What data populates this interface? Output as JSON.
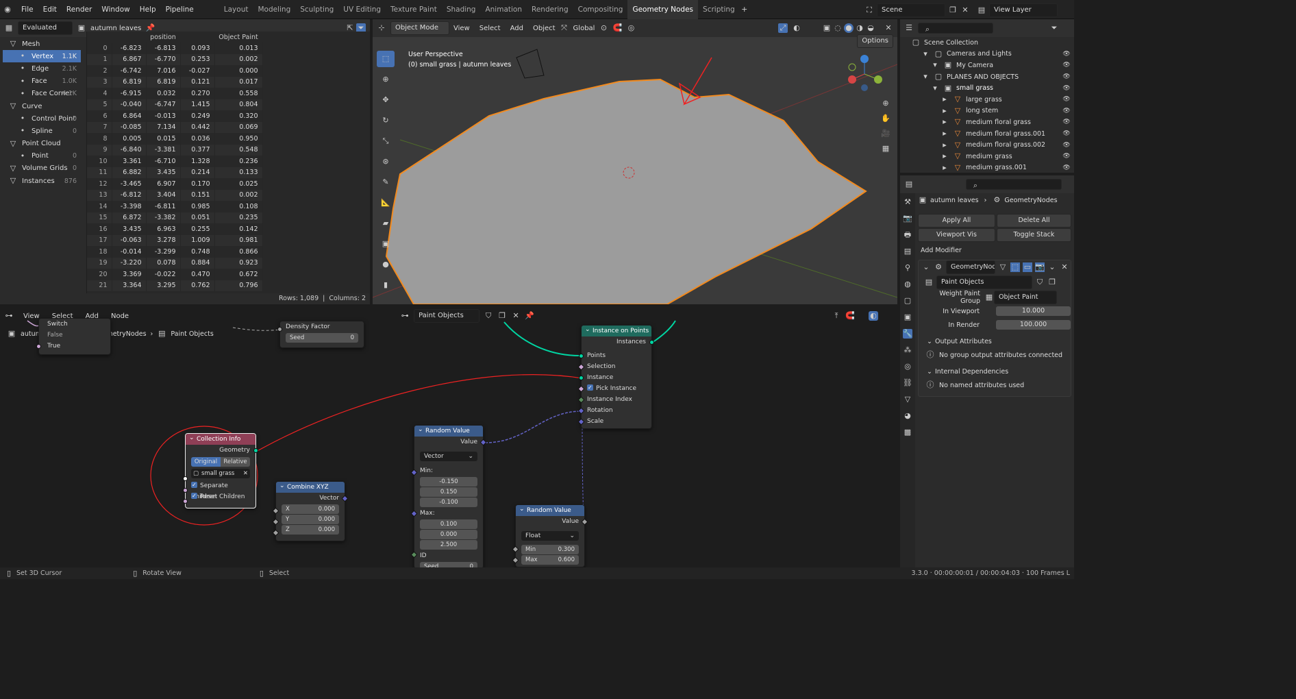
{
  "topbar": {
    "menus": [
      "File",
      "Edit",
      "Render",
      "Window",
      "Help",
      "Pipeline"
    ],
    "workspaces": [
      "Layout",
      "Modeling",
      "Sculpting",
      "UV Editing",
      "Texture Paint",
      "Shading",
      "Animation",
      "Rendering",
      "Compositing",
      "Geometry Nodes",
      "Scripting"
    ],
    "active_workspace": "Geometry Nodes",
    "scene": "Scene",
    "view_layer": "View Layer"
  },
  "spreadsheet": {
    "mode": "Evaluated",
    "object": "autumn leaves",
    "sidebar": [
      {
        "label": "Mesh",
        "count": "",
        "sub": false
      },
      {
        "label": "Vertex",
        "count": "1.1K",
        "sub": true,
        "selected": true
      },
      {
        "label": "Edge",
        "count": "2.1K",
        "sub": true
      },
      {
        "label": "Face",
        "count": "1.0K",
        "sub": true
      },
      {
        "label": "Face Corner",
        "count": "4.1K",
        "sub": true
      },
      {
        "label": "Curve",
        "count": "",
        "sub": false
      },
      {
        "label": "Control Point",
        "count": "0",
        "sub": true
      },
      {
        "label": "Spline",
        "count": "0",
        "sub": true
      },
      {
        "label": "Point Cloud",
        "count": "",
        "sub": false
      },
      {
        "label": "Point",
        "count": "0",
        "sub": true
      },
      {
        "label": "Volume Grids",
        "count": "0",
        "sub": false
      },
      {
        "label": "Instances",
        "count": "876",
        "sub": false
      }
    ],
    "columns": [
      "position",
      "Object Paint"
    ],
    "rows": [
      [
        "0",
        "-6.823",
        "-6.813",
        "0.093",
        "0.013"
      ],
      [
        "1",
        "6.867",
        "-6.770",
        "0.253",
        "0.002"
      ],
      [
        "2",
        "-6.742",
        "7.016",
        "-0.027",
        "0.000"
      ],
      [
        "3",
        "6.819",
        "6.819",
        "0.121",
        "0.017"
      ],
      [
        "4",
        "-6.915",
        "0.032",
        "0.270",
        "0.558"
      ],
      [
        "5",
        "-0.040",
        "-6.747",
        "1.415",
        "0.804"
      ],
      [
        "6",
        "6.864",
        "-0.013",
        "0.249",
        "0.320"
      ],
      [
        "7",
        "-0.085",
        "7.134",
        "0.442",
        "0.069"
      ],
      [
        "8",
        "0.005",
        "0.015",
        "0.036",
        "0.950"
      ],
      [
        "9",
        "-6.840",
        "-3.381",
        "0.377",
        "0.548"
      ],
      [
        "10",
        "3.361",
        "-6.710",
        "1.328",
        "0.236"
      ],
      [
        "11",
        "6.882",
        "3.435",
        "0.214",
        "0.133"
      ],
      [
        "12",
        "-3.465",
        "6.907",
        "0.170",
        "0.025"
      ],
      [
        "13",
        "-6.812",
        "3.404",
        "0.151",
        "0.002"
      ],
      [
        "14",
        "-3.398",
        "-6.811",
        "0.985",
        "0.108"
      ],
      [
        "15",
        "6.872",
        "-3.382",
        "0.051",
        "0.235"
      ],
      [
        "16",
        "3.435",
        "6.963",
        "0.255",
        "0.142"
      ],
      [
        "17",
        "-0.063",
        "3.278",
        "1.009",
        "0.981"
      ],
      [
        "18",
        "-0.014",
        "-3.299",
        "0.748",
        "0.866"
      ],
      [
        "19",
        "-3.220",
        "0.078",
        "0.884",
        "0.923"
      ],
      [
        "20",
        "3.369",
        "-0.022",
        "0.470",
        "0.672"
      ],
      [
        "21",
        "3.364",
        "3.295",
        "0.762",
        "0.796"
      ]
    ],
    "footer": {
      "rows": "Rows: 1,089",
      "columns": "Columns: 2"
    }
  },
  "viewport": {
    "mode": "Object Mode",
    "menus": [
      "View",
      "Select",
      "Add",
      "Object"
    ],
    "orientation": "Global",
    "options": "Options",
    "info_line1": "User Perspective",
    "info_line2": "(0) small grass  | autumn leaves"
  },
  "outliner": {
    "title": "Scene Collection",
    "items": [
      {
        "label": "Cameras and Lights",
        "depth": 1
      },
      {
        "label": "My Camera",
        "depth": 2
      },
      {
        "label": "PLANES AND OBJECTS",
        "depth": 1
      },
      {
        "label": "small grass",
        "depth": 2,
        "selected": true
      },
      {
        "label": "large grass",
        "depth": 3
      },
      {
        "label": "long stem",
        "depth": 3
      },
      {
        "label": "medium  floral grass",
        "depth": 3
      },
      {
        "label": "medium  floral grass.001",
        "depth": 3
      },
      {
        "label": "medium  floral grass.002",
        "depth": 3
      },
      {
        "label": "medium grass",
        "depth": 3
      },
      {
        "label": "medium grass.001",
        "depth": 3
      }
    ]
  },
  "properties": {
    "breadcrumb_obj": "autumn leaves",
    "breadcrumb_mod": "GeometryNodes",
    "apply_all": "Apply All",
    "delete_all": "Delete All",
    "viewport_vis": "Viewport Vis",
    "toggle_stack": "Toggle Stack",
    "add_modifier": "Add Modifier",
    "modifier_name": "GeometryNod...",
    "node_group": "Paint Objects",
    "weight_label": "Weight Paint Group",
    "weight_value": "Object Paint",
    "in_viewport_label": "In Viewport",
    "in_viewport": "10.000",
    "in_render_label": "In Render",
    "in_render": "100.000",
    "output_attrs": "Output Attributes",
    "output_msg": "No group output attributes connected",
    "internal_deps": "Internal Dependencies",
    "internal_msg": "No named attributes used"
  },
  "node_editor": {
    "menus": [
      "View",
      "Select",
      "Add",
      "Node"
    ],
    "tree": "Paint Objects",
    "breadcrumb": [
      "autumn leaves",
      "GeometryNodes",
      "Paint Objects"
    ],
    "switch": {
      "title": "Switch",
      "false": "False",
      "true": "True"
    },
    "density": {
      "label": "Density Factor",
      "seed_label": "Seed",
      "seed": "0"
    },
    "instance_on_points": {
      "title": "Instance on Points",
      "instances": "Instances",
      "inputs": [
        "Points",
        "Selection",
        "Instance",
        "Pick Instance",
        "Instance Index",
        "Rotation",
        "Scale"
      ]
    },
    "collection_info": {
      "title": "Collection Info",
      "geometry": "Geometry",
      "original": "Original",
      "relative": "Relative",
      "collection": "small grass",
      "separate": "Separate Children",
      "reset": "Reset Children"
    },
    "combine_xyz": {
      "title": "Combine XYZ",
      "vector": "Vector",
      "x": "X",
      "xv": "0.000",
      "y": "Y",
      "yv": "0.000",
      "z": "Z",
      "zv": "0.000"
    },
    "random_vec": {
      "title": "Random Value",
      "value": "Value",
      "type": "Vector",
      "min": "Min:",
      "min_vals": [
        "-0.150",
        "0.150",
        "-0.100"
      ],
      "max": "Max:",
      "max_vals": [
        "0.100",
        "0.000",
        "2.500"
      ],
      "id": "ID",
      "seed": "Seed",
      "seed_v": "0"
    },
    "random_flt": {
      "title": "Random Value",
      "value": "Value",
      "type": "Float",
      "min": "Min",
      "min_v": "0.300",
      "max": "Max",
      "max_v": "0.600"
    }
  },
  "statusbar": {
    "left": "Set 3D Cursor",
    "mid": "Rotate View",
    "right": "Select",
    "version": "3.3.0 · 00:00:00:01 / 00:00:04:03 · 100 Frames L"
  }
}
